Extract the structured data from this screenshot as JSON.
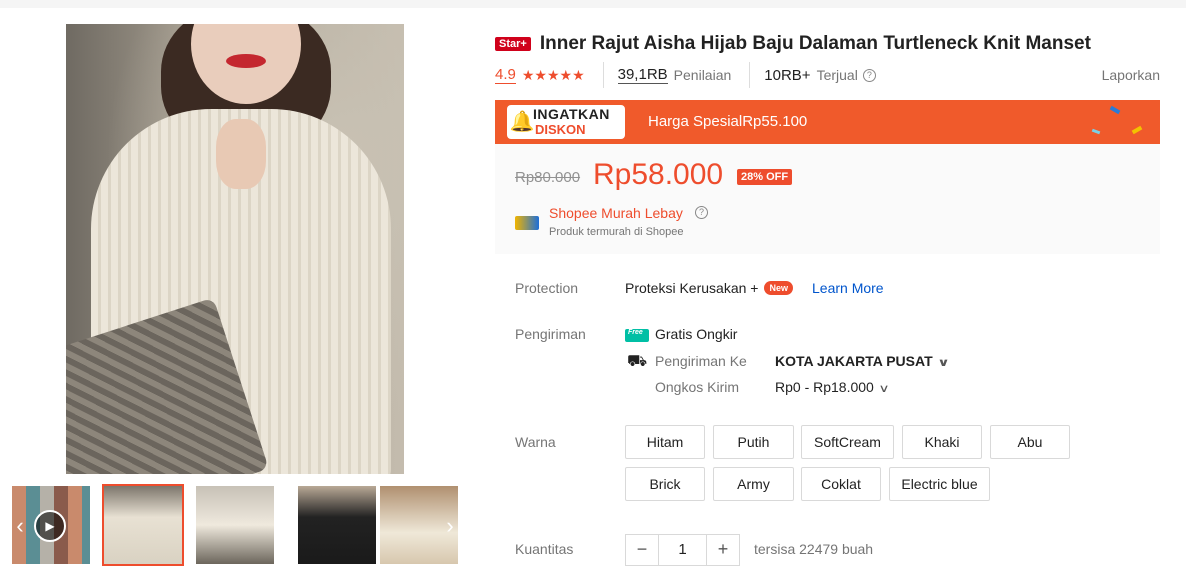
{
  "gallery": {
    "thumbnails": [
      {
        "name": "thumb-1",
        "has_video": true
      },
      {
        "name": "thumb-2",
        "active": true
      },
      {
        "name": "thumb-3"
      },
      {
        "name": "thumb-4"
      },
      {
        "name": "thumb-5"
      }
    ],
    "prev_icon": "‹",
    "next_icon": "›",
    "play_icon": "▶"
  },
  "product": {
    "badge": "Star+",
    "title": "Inner Rajut Aisha Hijab Baju Dalaman Turtleneck Knit Manset",
    "rating": "4.9",
    "stars": "★★★★★",
    "ratings_count": "39,1RB",
    "ratings_label": "Penilaian",
    "sold_count": "10RB+",
    "sold_label": "Terjual",
    "help_icon": "?",
    "report": "Laporkan"
  },
  "promo": {
    "logo_line1": "INGATKAN",
    "logo_line2": "DISKON",
    "text": "Harga SpesialRp55.100",
    "accent": "#f05a2b"
  },
  "price": {
    "original": "Rp80.000",
    "current": "Rp58.000",
    "discount": "28% OFF",
    "murah_title": "Shopee Murah Lebay",
    "murah_sub": "Produk termurah di Shopee",
    "accent": "#ee4d2d"
  },
  "protection": {
    "label": "Protection",
    "value": "Proteksi Kerusakan +",
    "new_badge": "New",
    "learn_more": "Learn More"
  },
  "shipping": {
    "label": "Pengiriman",
    "free_icon_text": "Free",
    "free_text": "Gratis Ongkir",
    "ship_to_label": "Pengiriman Ke",
    "ship_to_value": "KOTA JAKARTA PUSAT",
    "cost_label": "Ongkos Kirim",
    "cost_value": "Rp0 - Rp18.000",
    "chevron": "∨"
  },
  "variants": {
    "label": "Warna",
    "options": [
      "Hitam",
      "Putih",
      "SoftCream",
      "Khaki",
      "Abu",
      "Brick",
      "Army",
      "Coklat",
      "Electric blue"
    ]
  },
  "quantity": {
    "label": "Kuantitas",
    "minus": "−",
    "value": "1",
    "plus": "+",
    "stock": "tersisa 22479 buah"
  }
}
